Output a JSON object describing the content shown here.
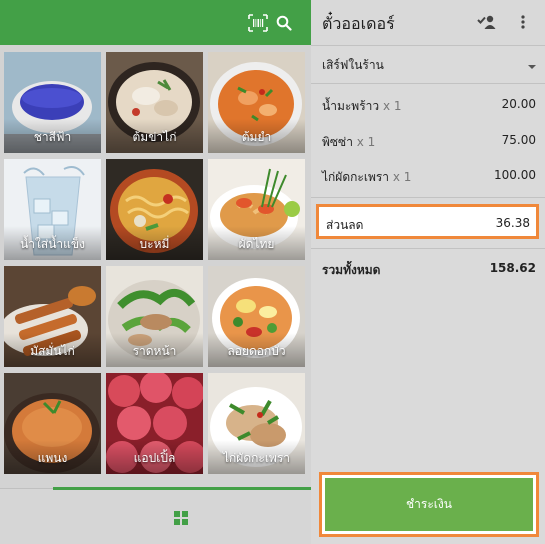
{
  "colors": {
    "accent": "#43a047",
    "highlight": "#f0883a",
    "pay": "#6ab04c"
  },
  "left": {
    "icons": [
      "barcode-icon",
      "search-icon"
    ],
    "tiles": [
      {
        "label": "ชาสีฟ้า"
      },
      {
        "label": "ต้มข่าไก่"
      },
      {
        "label": "ต้มยำ"
      },
      {
        "label": "น้ำใส่น้ำแข็ง"
      },
      {
        "label": "บะหมี่"
      },
      {
        "label": "ผัดไทย"
      },
      {
        "label": "มัสมั่นไก่"
      },
      {
        "label": "ราดหน้า"
      },
      {
        "label": "ลอยดอกบัว"
      },
      {
        "label": "แพนง"
      },
      {
        "label": "แอปเปิ้ล"
      },
      {
        "label": "ไก่ผัดกะเพรา"
      }
    ],
    "bottom_icon": "grid-icon"
  },
  "right": {
    "title": "ตั๋วออเดอร์",
    "dining_option": "เสิร์ฟในร้าน",
    "items": [
      {
        "name": "น้ำมะพร้าว",
        "qty": "x 1",
        "price": "20.00"
      },
      {
        "name": "พิซซ่า",
        "qty": "x 1",
        "price": "75.00"
      },
      {
        "name": "ไก่ผัดกะเพรา",
        "qty": "x 1",
        "price": "100.00"
      }
    ],
    "discount": {
      "label": "ส่วนลด",
      "value": "36.38"
    },
    "total": {
      "label": "รวมทั้งหมด",
      "value": "158.62"
    },
    "pay_label": "ชำระเงิน"
  }
}
